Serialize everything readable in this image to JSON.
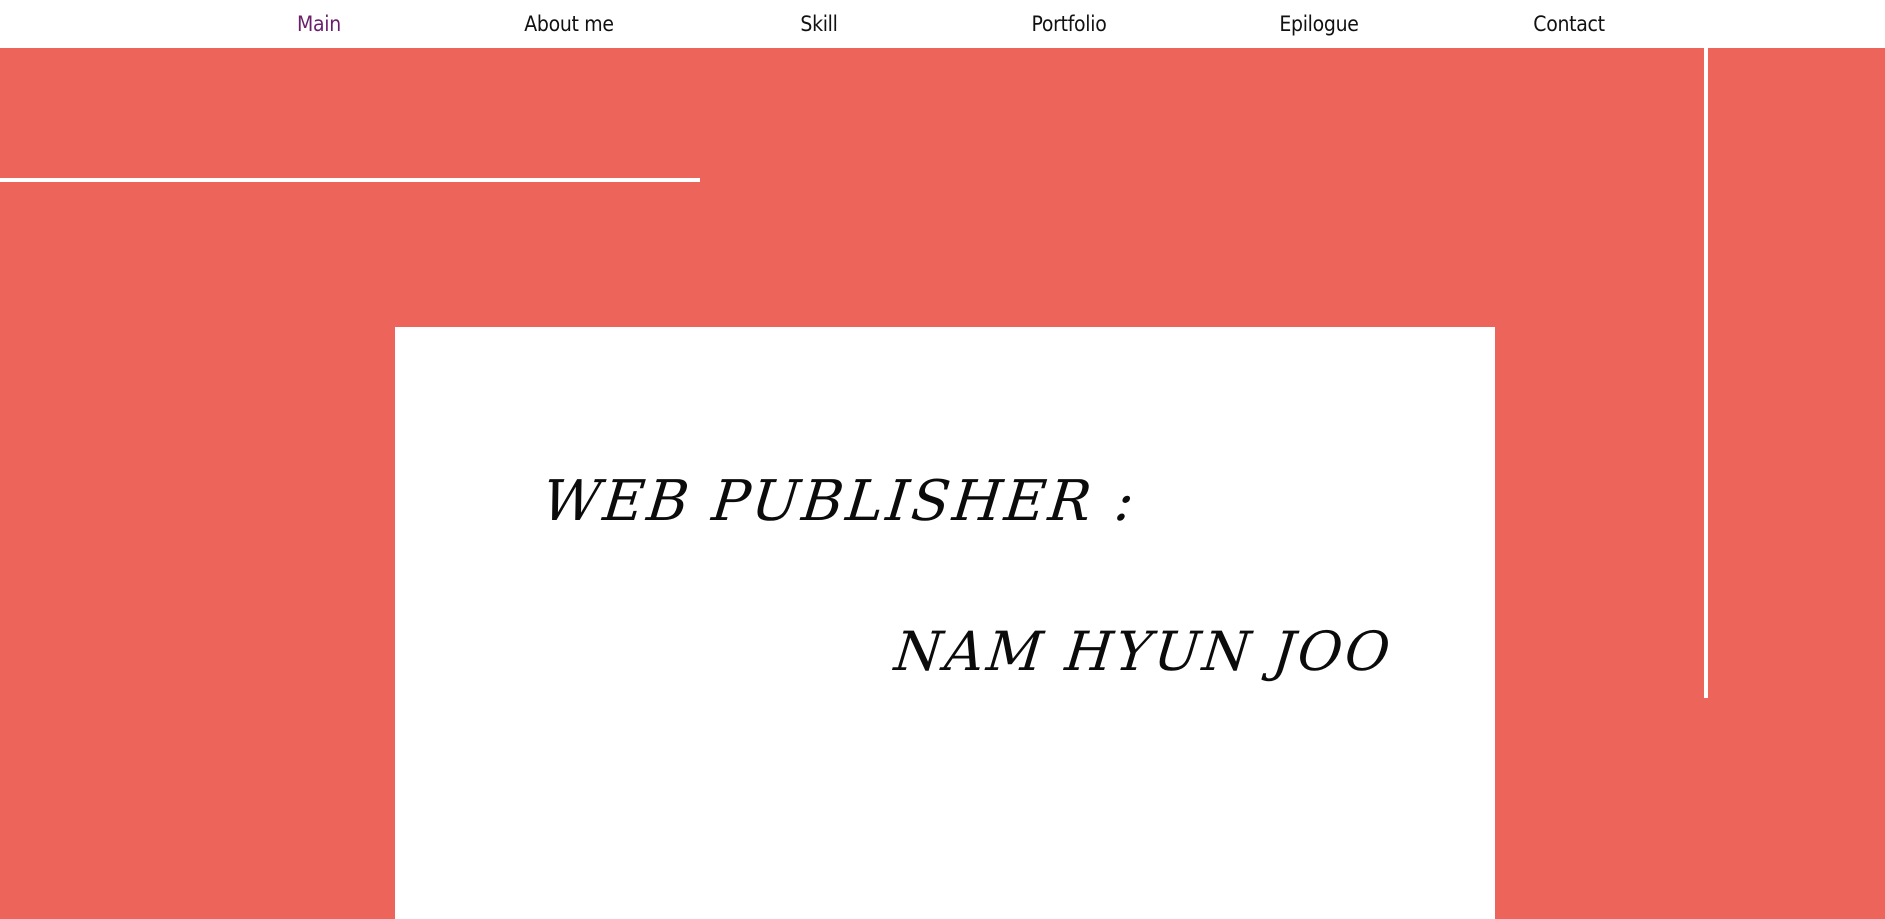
{
  "nav": {
    "items": [
      {
        "label": "Main",
        "active": true
      },
      {
        "label": "About me",
        "active": false
      },
      {
        "label": "Skill",
        "active": false
      },
      {
        "label": "Portfolio",
        "active": false
      },
      {
        "label": "Epilogue",
        "active": false
      },
      {
        "label": "Contact",
        "active": false
      }
    ]
  },
  "hero": {
    "role": "WEB PUBLISHER :",
    "name": "NAM HYUN JOO"
  },
  "colors": {
    "accent": "#ed655a",
    "active_nav": "#6b1f6b",
    "text": "#111111",
    "card": "#ffffff"
  }
}
